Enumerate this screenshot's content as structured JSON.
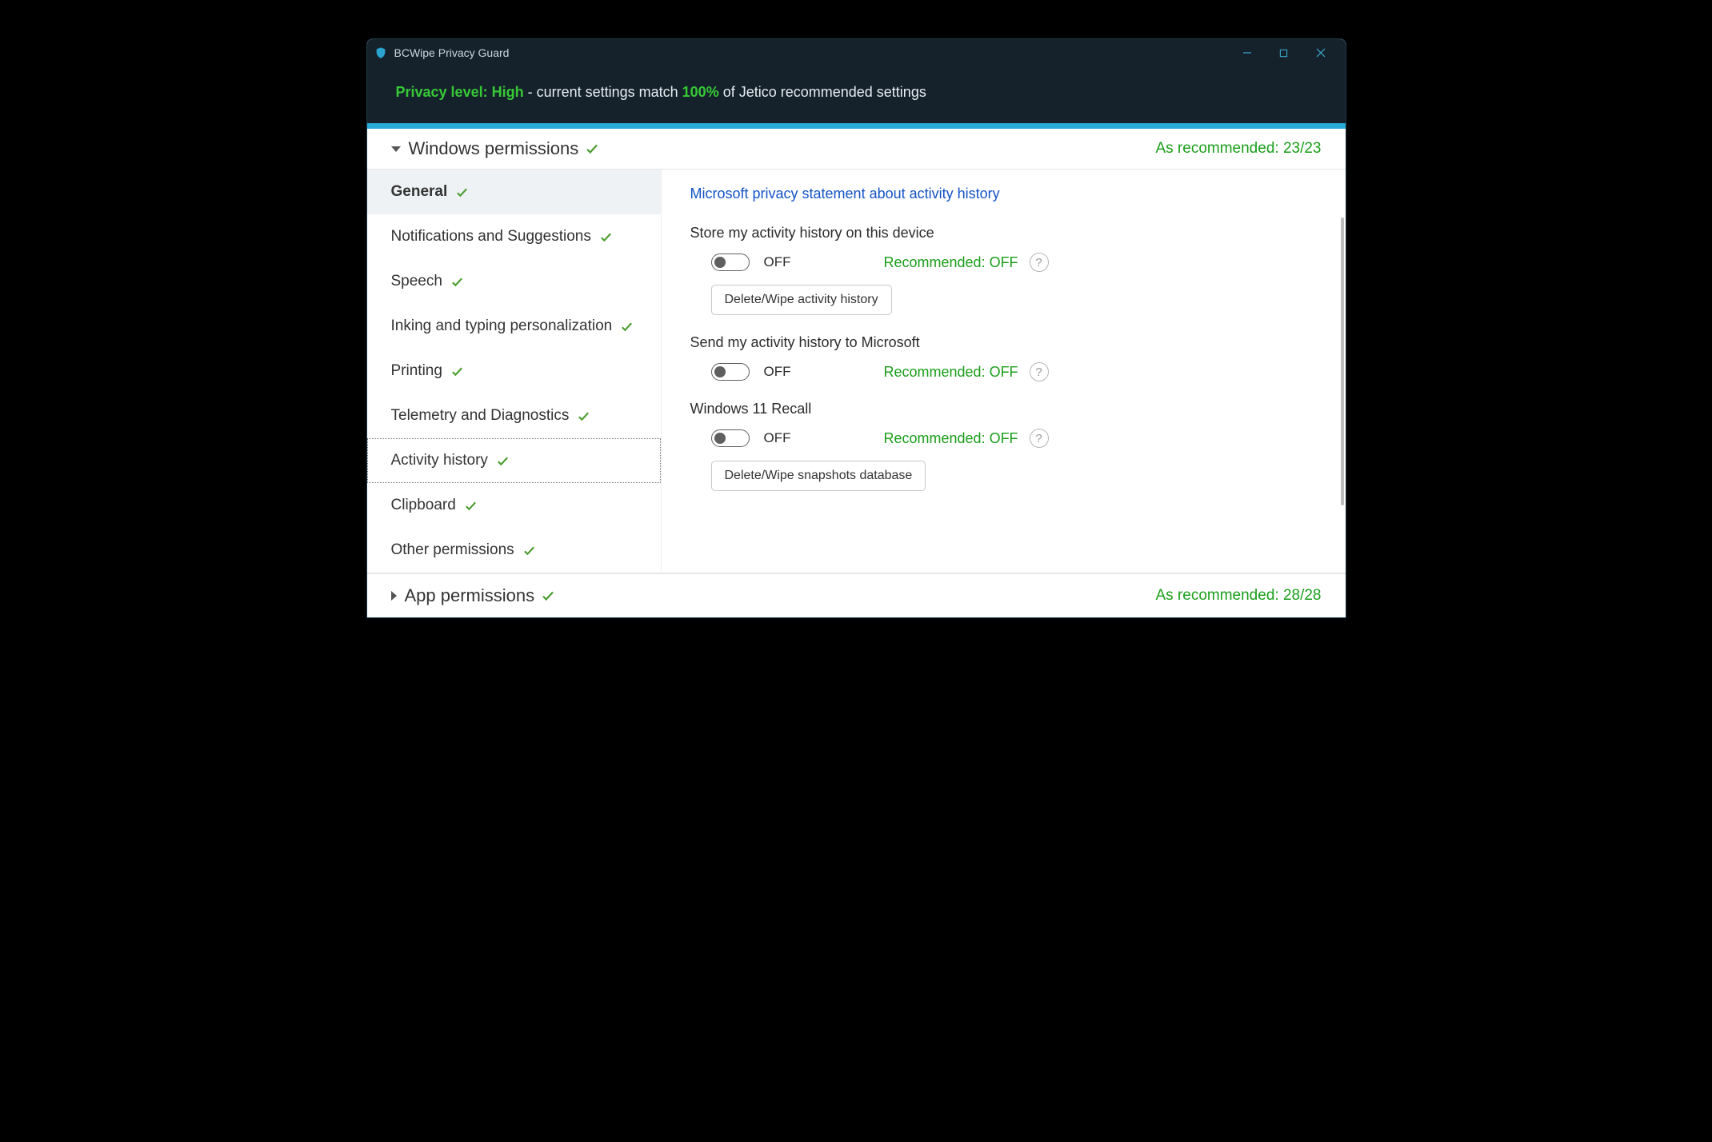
{
  "app": {
    "title": "BCWipe Privacy Guard"
  },
  "banner": {
    "privLabel": "Privacy level: High",
    "mid1": " - current settings match ",
    "pct": "100%",
    "mid2": " of Jetico recommended settings"
  },
  "sections": {
    "windows": {
      "title": "Windows permissions",
      "reco": "As recommended: 23/23"
    },
    "app": {
      "title": "App permissions",
      "reco": "As recommended: 28/28"
    }
  },
  "sidebar": [
    {
      "label": "General",
      "active": true
    },
    {
      "label": "Notifications and Suggestions"
    },
    {
      "label": "Speech"
    },
    {
      "label": "Inking and typing personalization"
    },
    {
      "label": "Printing"
    },
    {
      "label": "Telemetry and Diagnostics"
    },
    {
      "label": "Activity history",
      "focused": true
    },
    {
      "label": "Clipboard"
    },
    {
      "label": "Other permissions"
    }
  ],
  "content": {
    "link": "Microsoft privacy statement about activity history",
    "settings": [
      {
        "title": "Store my activity history on this device",
        "state": "OFF",
        "reco": "Recommended: OFF",
        "action": "Delete/Wipe activity history"
      },
      {
        "title": "Send my activity history to Microsoft",
        "state": "OFF",
        "reco": "Recommended: OFF"
      },
      {
        "title": "Windows 11 Recall",
        "state": "OFF",
        "reco": "Recommended: OFF",
        "action": "Delete/Wipe snapshots database"
      }
    ]
  },
  "helpGlyph": "?"
}
